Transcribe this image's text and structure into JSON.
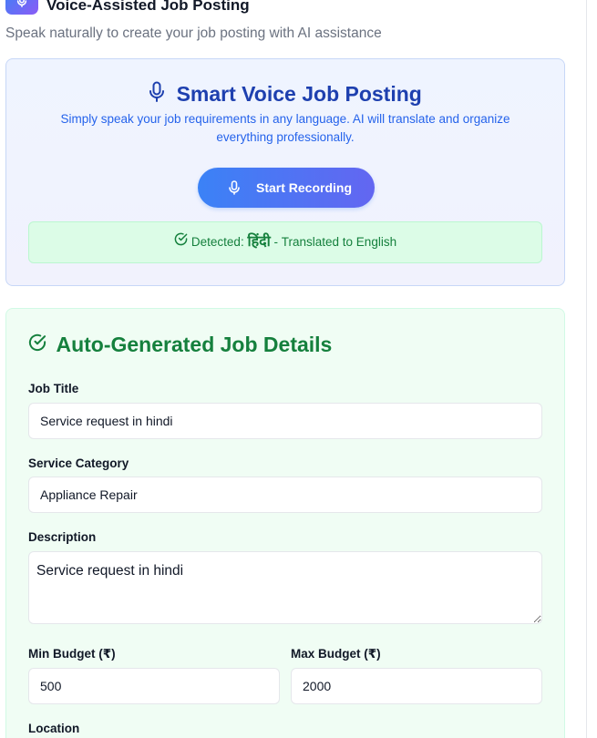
{
  "header": {
    "title": "Voice-Assisted Job Posting",
    "subtitle": "Speak naturally to create your job posting with AI assistance"
  },
  "voice": {
    "title": "Smart Voice Job Posting",
    "description": "Simply speak your job requirements in any language. AI will translate and organize everything professionally.",
    "record_label": "Start Recording",
    "detected_prefix": "Detected:",
    "detected_language": "हिंदी",
    "detected_suffix": "- Translated to English"
  },
  "details": {
    "title": "Auto-Generated Job Details",
    "job_title": {
      "label": "Job Title",
      "value": "Service request in hindi"
    },
    "category": {
      "label": "Service Category",
      "value": "Appliance Repair"
    },
    "description": {
      "label": "Description",
      "value": "Service request in hindi"
    },
    "min_budget": {
      "label": "Min Budget (₹)",
      "value": "500"
    },
    "max_budget": {
      "label": "Max Budget (₹)",
      "value": "2000"
    },
    "location": {
      "label": "Location"
    }
  },
  "colors": {
    "primary_blue": "#1e40af",
    "accent_green": "#15803d",
    "gradient_start": "#3b82f6",
    "gradient_end": "#6366f1"
  },
  "icons": [
    "microphone-icon",
    "check-circle-icon"
  ]
}
